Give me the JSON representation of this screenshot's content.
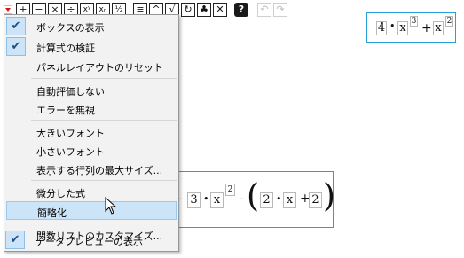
{
  "toolbar": {
    "buttons": [
      {
        "icon": "plus-icon",
        "glyph": "+"
      },
      {
        "icon": "minus-icon",
        "glyph": "−"
      },
      {
        "icon": "multiply-icon",
        "glyph": "×"
      },
      {
        "icon": "divide-icon",
        "glyph": "÷"
      },
      {
        "icon": "power-icon",
        "glyph": "xʸ"
      },
      {
        "icon": "subscript-icon",
        "glyph": "xₙ"
      },
      {
        "icon": "fraction-icon",
        "glyph": "½"
      },
      {
        "icon": "list-icon",
        "glyph": "≡"
      },
      {
        "icon": "caret-icon",
        "glyph": "^"
      },
      {
        "icon": "sqrt-icon",
        "glyph": "√"
      },
      {
        "icon": "refresh-icon",
        "glyph": "↻"
      },
      {
        "icon": "tree-icon",
        "glyph": "♣"
      },
      {
        "icon": "delete-icon",
        "glyph": "✕"
      }
    ],
    "help_glyph": "?",
    "undo_glyph": "↶",
    "redo_glyph": "↷"
  },
  "menu": {
    "items": [
      {
        "label": "ボックスの表示",
        "checked": true
      },
      {
        "label": "計算式の検証",
        "checked": true
      },
      {
        "label": "パネルレイアウトのリセット",
        "checked": false
      },
      {
        "label": "自動評価しない",
        "checked": false
      },
      {
        "label": "エラーを無視",
        "checked": false
      },
      {
        "label": "大きいフォント",
        "checked": false
      },
      {
        "label": "小さいフォント",
        "checked": false
      },
      {
        "label": "表示する行列の最大サイズ...",
        "checked": false
      },
      {
        "label": "微分した式",
        "checked": false
      },
      {
        "label": "簡略化",
        "checked": false,
        "highlighted": true
      },
      {
        "label": "関数リストのカスタマイズ...",
        "checked": false
      },
      {
        "label": "データプレビューの表示",
        "checked": true
      }
    ],
    "check_glyph": "✔"
  },
  "expr_top": {
    "coef": "4",
    "dot": "•",
    "var": "x",
    "exp": "3",
    "plus": "+",
    "var2": "x",
    "exp2": "2"
  },
  "expr_main": {
    "minus1": "-",
    "coef": "3",
    "dot": "•",
    "var": "x",
    "exp": "2",
    "minus2": "-",
    "lparen": "(",
    "coef2": "2",
    "dot2": "•",
    "var2": "x",
    "plus": "+",
    "const": "2",
    "rparen": ")"
  },
  "colors": {
    "accent": "#27a0d8",
    "menu_bg": "#f2f2f2",
    "highlight": "#cce4f7",
    "check_bg": "#cde3f7"
  }
}
